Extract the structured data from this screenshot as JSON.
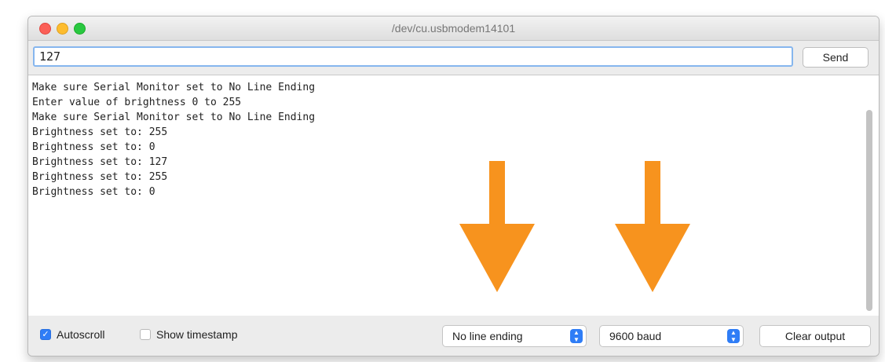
{
  "window": {
    "title": "/dev/cu.usbmodem14101"
  },
  "input": {
    "value": "127",
    "send_label": "Send"
  },
  "output": {
    "lines": [
      "Make sure Serial Monitor set to No Line Ending",
      "Enter value of brightness 0 to 255",
      "Make sure Serial Monitor set to No Line Ending",
      "Brightness set to: 255",
      "Brightness set to: 0",
      "Brightness set to: 127",
      "Brightness set to: 255",
      "Brightness set to: 0"
    ]
  },
  "statusbar": {
    "autoscroll_label": "Autoscroll",
    "autoscroll_checked": true,
    "timestamp_label": "Show timestamp",
    "timestamp_checked": false,
    "line_ending_value": "No line ending",
    "baud_value": "9600 baud",
    "clear_label": "Clear output"
  },
  "annotations": {
    "arrow_color": "#f7931e"
  }
}
